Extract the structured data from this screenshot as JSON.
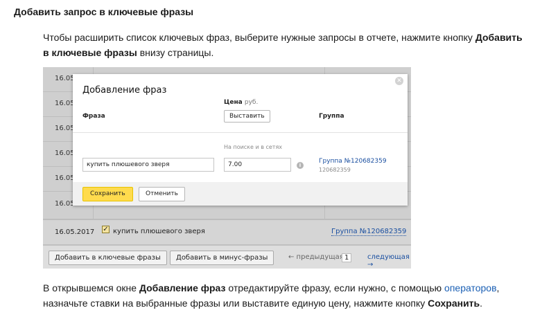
{
  "doc": {
    "heading": "Добавить запрос в ключевые фразы",
    "intro_part1": "Чтобы расширить список ключевых фраз, выберите нужные запросы в отчете, нажмите кнопку ",
    "intro_bold": "Добавить в ключевые фразы",
    "intro_part2": " внизу страницы.",
    "outro_part1": "В открывшемся окне ",
    "outro_bold1": "Добавление фраз",
    "outro_part2": " отредактируйте фразу, если нужно, с помощью ",
    "outro_link": "операторов",
    "outro_part3": ", назначьте ставки на выбранные фразы или выставите единую цену, нажмите кнопку ",
    "outro_bold2": "Сохранить",
    "outro_part4": "."
  },
  "background_table": {
    "row_dates": [
      "16.05",
      "16.05",
      "16.05",
      "16.05",
      "16.05",
      "16.05"
    ],
    "visible_row": {
      "date": "16.05.2017",
      "checked": true,
      "phrase": "купить плюшевого зверя",
      "group": "Группа №120682359"
    },
    "footer": {
      "add_keywords": "Добавить в ключевые фразы",
      "add_minus": "Добавить в минус-фразы",
      "prev": "← предыдущая",
      "page": "1",
      "next": "следующая →"
    }
  },
  "modal": {
    "title": "Добавление фраз",
    "col_phrase": "Фраза",
    "col_price": "Цена",
    "col_price_unit": "руб.",
    "set_button": "Выставить",
    "col_group": "Группа",
    "sub_label": "На поиске и в сетях",
    "phrase_value": "купить плюшевого зверя",
    "price_value": "7.00",
    "group_link": "Группа №120682359",
    "group_id": "120682359",
    "save": "Сохранить",
    "cancel": "Отменить",
    "close_icon": "close-icon",
    "info_icon": "info-icon"
  },
  "colors": {
    "link": "#1a5fb4",
    "save_button": "#ffdb4d"
  }
}
